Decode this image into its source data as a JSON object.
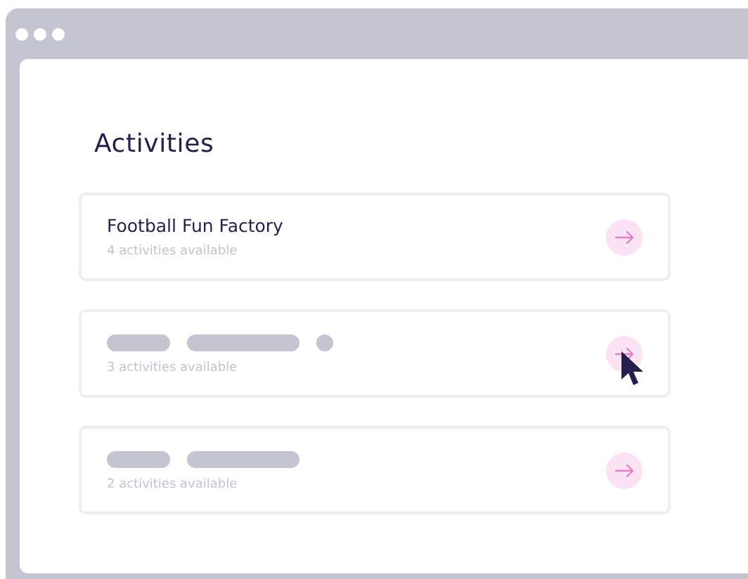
{
  "heading": "Activities",
  "cards": [
    {
      "kind": "named",
      "title": "Football Fun Factory",
      "subtitle": "4 activities available",
      "hovered": false
    },
    {
      "kind": "skeleton",
      "dot": true,
      "subtitle": "3 activities available",
      "hovered": true
    },
    {
      "kind": "skeleton",
      "dot": false,
      "subtitle": "2 activities available",
      "hovered": false
    }
  ]
}
